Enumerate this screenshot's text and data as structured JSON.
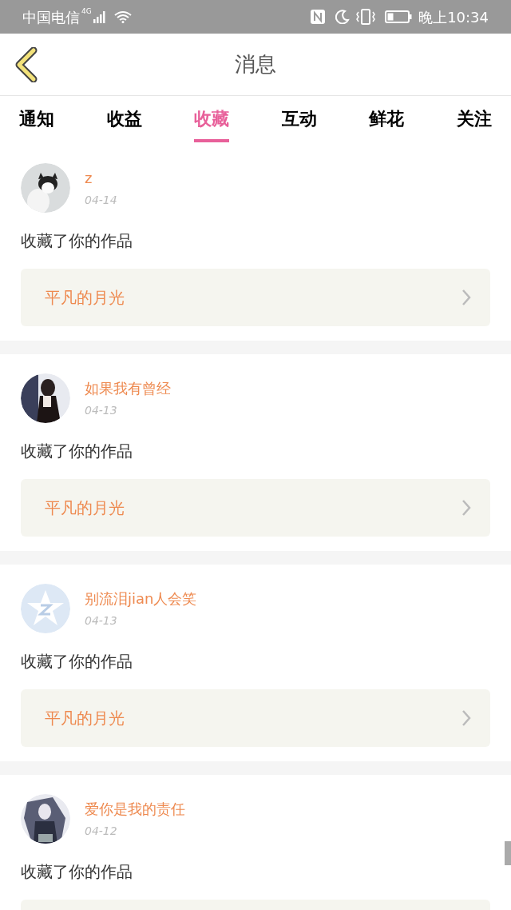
{
  "status_bar": {
    "carrier": "中国电信",
    "network": "4G",
    "time": "晚上10:34"
  },
  "header": {
    "title": "消息"
  },
  "tabs": [
    {
      "label": "通知",
      "selected": false
    },
    {
      "label": "收益",
      "selected": false
    },
    {
      "label": "收藏",
      "selected": true
    },
    {
      "label": "互动",
      "selected": false
    },
    {
      "label": "鲜花",
      "selected": false
    },
    {
      "label": "关注",
      "selected": false
    }
  ],
  "messages": [
    {
      "name": "z",
      "date": "04-14",
      "text": "收藏了你的作品",
      "work": "平凡的月光"
    },
    {
      "name": "如果我有曾经",
      "date": "04-13",
      "text": "收藏了你的作品",
      "work": "平凡的月光"
    },
    {
      "name": "别流泪jian人会笑",
      "date": "04-13",
      "text": "收藏了你的作品",
      "work": "平凡的月光"
    },
    {
      "name": "爱你是我的责任",
      "date": "04-12",
      "text": "收藏了你的作品"
    }
  ]
}
